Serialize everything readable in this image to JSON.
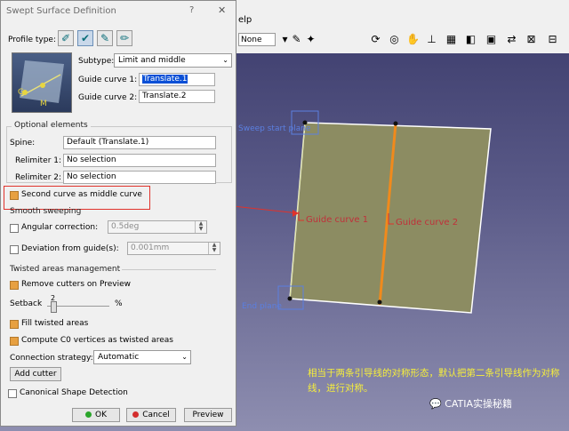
{
  "dialog": {
    "title": "Swept Surface Definition",
    "help_glyph": "?",
    "close_glyph": "✕",
    "profile_type_label": "Profile type:",
    "subtype_label": "Subtype:",
    "subtype_value": "Limit and middle",
    "guide_curve_1_label": "Guide curve 1:",
    "guide_curve_1_value": "Translate.1",
    "guide_curve_2_label": "Guide curve 2:",
    "guide_curve_2_value": "Translate.2",
    "preview_labels": {
      "g": "G",
      "m": "M"
    },
    "optional_elements_label": "Optional elements",
    "spine_label": "Spine:",
    "spine_value": "Default (Translate.1)",
    "relimiter1_label": "Relimiter 1:",
    "relimiter1_value": "No selection",
    "relimiter2_label": "Relimiter 2:",
    "relimiter2_value": "No selection",
    "second_curve_middle_label": "Second curve as middle curve",
    "smooth_sweeping_label": "Smooth sweeping",
    "angular_correction_label": "Angular correction:",
    "angular_correction_value": "0.5deg",
    "deviation_label": "Deviation from guide(s):",
    "deviation_value": "0.001mm",
    "twisted_areas_label": "Twisted areas management",
    "remove_cutters_label": "Remove cutters on Preview",
    "setback_label": "Setback",
    "setback_value": "2",
    "setback_unit": "%",
    "fill_twisted_label": "Fill twisted areas",
    "compute_c0_label": "Compute C0 vertices as twisted areas",
    "connection_strategy_label": "Connection strategy:",
    "connection_strategy_value": "Automatic",
    "add_cutter_label": "Add cutter",
    "canonical_shape_label": "Canonical Shape Detection",
    "ok_label": "OK",
    "cancel_label": "Cancel",
    "preview_label": "Preview"
  },
  "app_toolbar": {
    "menu_help": "elp",
    "combo_value": "None"
  },
  "scene": {
    "guide_curve_1": "Guide curve 1",
    "guide_curve_2": "Guide curve 2",
    "sweep_start_plane": "Sweep start plane",
    "end_plane": "End plane"
  },
  "annotation": {
    "text": "相当于两条引导线的对称形态，默认把第二条引导线作为对称线，进行对称。",
    "watermark": "CATIA实操秘籍"
  },
  "colors": {
    "surface_fill": "#8c8c62",
    "guide_curve_orange": "#f08a1c",
    "highlight_red": "#e0322b",
    "annotation_yellow": "#f7ef3a",
    "checkbox_checked": "#e7a041"
  }
}
